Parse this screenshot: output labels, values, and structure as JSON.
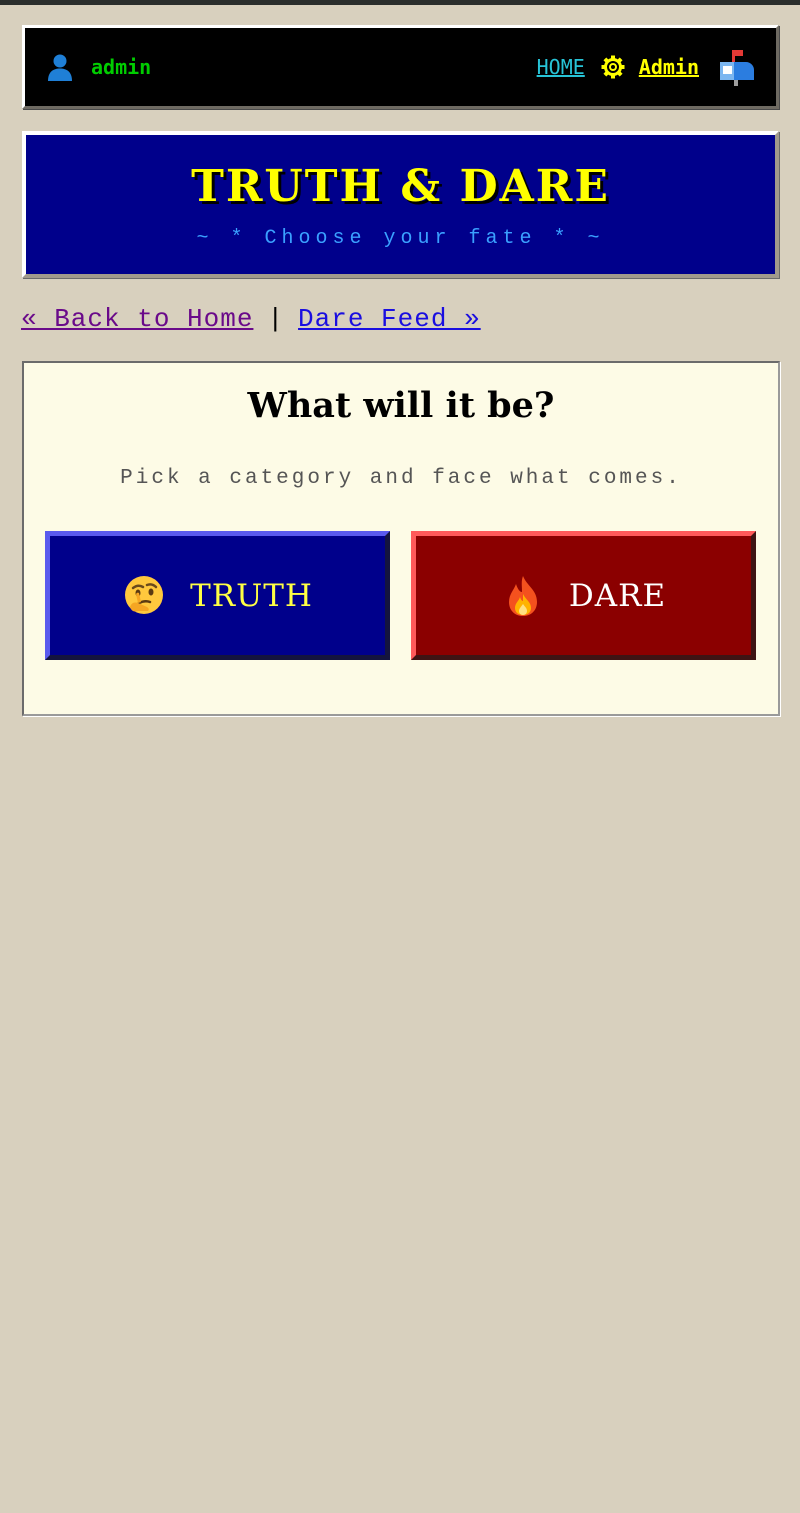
{
  "topbar": {
    "username": "admin",
    "home_label": "HOME",
    "admin_label": "Admin",
    "icons": {
      "user": "user-silhouette-icon",
      "gear": "gear-icon",
      "mailbox": "mailbox-icon"
    },
    "colors": {
      "username": "#00cc00",
      "home": "#27c3d6",
      "admin": "#ffff00"
    }
  },
  "banner": {
    "title": "TRUTH & DARE",
    "subtitle": "~ * Choose your fate * ~"
  },
  "links": {
    "back_label": "« Back to Home",
    "separator": "|",
    "feed_label": "Dare Feed »"
  },
  "panel": {
    "title": "What will it be?",
    "subtitle": "Pick a category and face what comes.",
    "buttons": [
      {
        "label": "TRUTH",
        "icon": "thinking-face-icon",
        "color": "#00008b"
      },
      {
        "label": "DARE",
        "icon": "fire-icon",
        "color": "#8b0000"
      }
    ]
  }
}
